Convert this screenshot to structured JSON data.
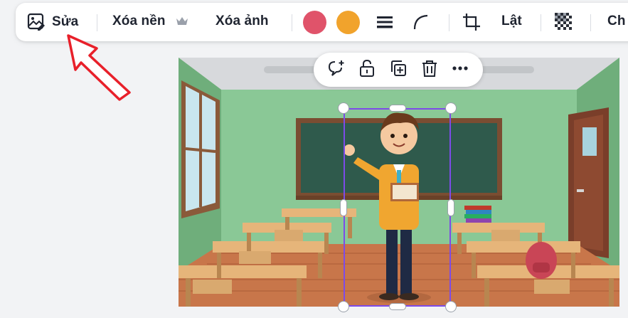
{
  "toolbar": {
    "edit_label": "Sửa",
    "remove_bg_label": "Xóa nền",
    "remove_image_label": "Xóa ảnh",
    "color_1": "#e0536a",
    "color_2": "#f1a32c",
    "flip_label": "Lật",
    "last_label": "Ch",
    "icons": [
      "image-edit-icon",
      "crown-icon",
      "line-weight-icon",
      "corner-radius-icon",
      "crop-icon",
      "transparency-icon"
    ]
  },
  "floating_toolbar": {
    "icons": [
      "comment-add-icon",
      "unlock-icon",
      "duplicate-icon",
      "trash-icon",
      "more-icon"
    ]
  },
  "canvas": {
    "image": "classroom-teacher-illustration"
  },
  "annotation": {
    "arrow_color": "#e8202a"
  }
}
